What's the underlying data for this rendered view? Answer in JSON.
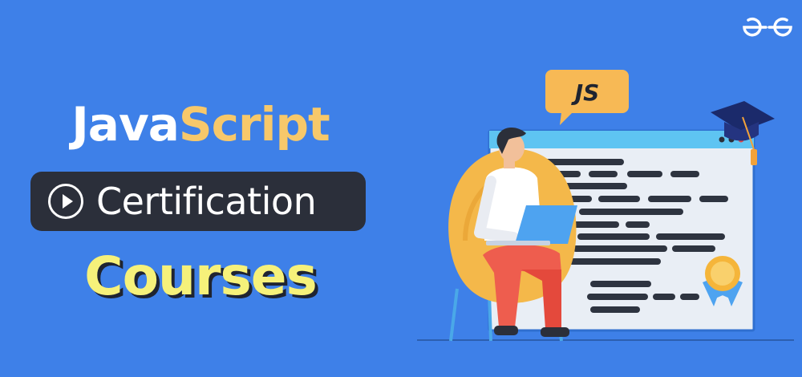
{
  "brand": {
    "logo_name": "gfg-logo"
  },
  "headline": {
    "word1": "Java",
    "word2": "Script",
    "subtitle": "Certification",
    "line3": "Courses"
  },
  "illustration": {
    "speech_bubble": "JS"
  },
  "colors": {
    "background": "#3e80e8",
    "accent_orange": "#f7c86a",
    "accent_yellow": "#f6f17a",
    "pill_dark": "#2b2f3a",
    "white": "#ffffff"
  }
}
